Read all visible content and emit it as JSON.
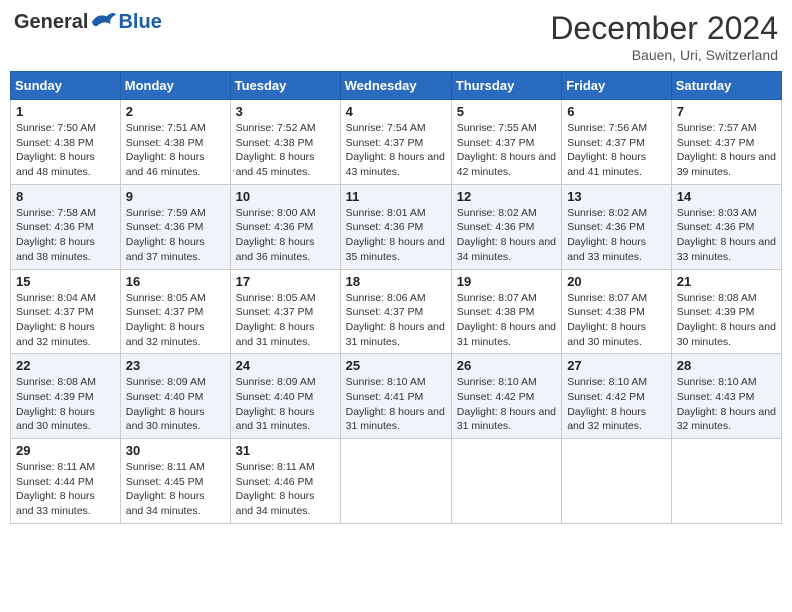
{
  "header": {
    "logo": {
      "general": "General",
      "blue": "Blue"
    },
    "title": "December 2024",
    "location": "Bauen, Uri, Switzerland"
  },
  "weekdays": [
    "Sunday",
    "Monday",
    "Tuesday",
    "Wednesday",
    "Thursday",
    "Friday",
    "Saturday"
  ],
  "weeks": [
    [
      {
        "day": "1",
        "sunrise": "Sunrise: 7:50 AM",
        "sunset": "Sunset: 4:38 PM",
        "daylight": "Daylight: 8 hours and 48 minutes."
      },
      {
        "day": "2",
        "sunrise": "Sunrise: 7:51 AM",
        "sunset": "Sunset: 4:38 PM",
        "daylight": "Daylight: 8 hours and 46 minutes."
      },
      {
        "day": "3",
        "sunrise": "Sunrise: 7:52 AM",
        "sunset": "Sunset: 4:38 PM",
        "daylight": "Daylight: 8 hours and 45 minutes."
      },
      {
        "day": "4",
        "sunrise": "Sunrise: 7:54 AM",
        "sunset": "Sunset: 4:37 PM",
        "daylight": "Daylight: 8 hours and 43 minutes."
      },
      {
        "day": "5",
        "sunrise": "Sunrise: 7:55 AM",
        "sunset": "Sunset: 4:37 PM",
        "daylight": "Daylight: 8 hours and 42 minutes."
      },
      {
        "day": "6",
        "sunrise": "Sunrise: 7:56 AM",
        "sunset": "Sunset: 4:37 PM",
        "daylight": "Daylight: 8 hours and 41 minutes."
      },
      {
        "day": "7",
        "sunrise": "Sunrise: 7:57 AM",
        "sunset": "Sunset: 4:37 PM",
        "daylight": "Daylight: 8 hours and 39 minutes."
      }
    ],
    [
      {
        "day": "8",
        "sunrise": "Sunrise: 7:58 AM",
        "sunset": "Sunset: 4:36 PM",
        "daylight": "Daylight: 8 hours and 38 minutes."
      },
      {
        "day": "9",
        "sunrise": "Sunrise: 7:59 AM",
        "sunset": "Sunset: 4:36 PM",
        "daylight": "Daylight: 8 hours and 37 minutes."
      },
      {
        "day": "10",
        "sunrise": "Sunrise: 8:00 AM",
        "sunset": "Sunset: 4:36 PM",
        "daylight": "Daylight: 8 hours and 36 minutes."
      },
      {
        "day": "11",
        "sunrise": "Sunrise: 8:01 AM",
        "sunset": "Sunset: 4:36 PM",
        "daylight": "Daylight: 8 hours and 35 minutes."
      },
      {
        "day": "12",
        "sunrise": "Sunrise: 8:02 AM",
        "sunset": "Sunset: 4:36 PM",
        "daylight": "Daylight: 8 hours and 34 minutes."
      },
      {
        "day": "13",
        "sunrise": "Sunrise: 8:02 AM",
        "sunset": "Sunset: 4:36 PM",
        "daylight": "Daylight: 8 hours and 33 minutes."
      },
      {
        "day": "14",
        "sunrise": "Sunrise: 8:03 AM",
        "sunset": "Sunset: 4:36 PM",
        "daylight": "Daylight: 8 hours and 33 minutes."
      }
    ],
    [
      {
        "day": "15",
        "sunrise": "Sunrise: 8:04 AM",
        "sunset": "Sunset: 4:37 PM",
        "daylight": "Daylight: 8 hours and 32 minutes."
      },
      {
        "day": "16",
        "sunrise": "Sunrise: 8:05 AM",
        "sunset": "Sunset: 4:37 PM",
        "daylight": "Daylight: 8 hours and 32 minutes."
      },
      {
        "day": "17",
        "sunrise": "Sunrise: 8:05 AM",
        "sunset": "Sunset: 4:37 PM",
        "daylight": "Daylight: 8 hours and 31 minutes."
      },
      {
        "day": "18",
        "sunrise": "Sunrise: 8:06 AM",
        "sunset": "Sunset: 4:37 PM",
        "daylight": "Daylight: 8 hours and 31 minutes."
      },
      {
        "day": "19",
        "sunrise": "Sunrise: 8:07 AM",
        "sunset": "Sunset: 4:38 PM",
        "daylight": "Daylight: 8 hours and 31 minutes."
      },
      {
        "day": "20",
        "sunrise": "Sunrise: 8:07 AM",
        "sunset": "Sunset: 4:38 PM",
        "daylight": "Daylight: 8 hours and 30 minutes."
      },
      {
        "day": "21",
        "sunrise": "Sunrise: 8:08 AM",
        "sunset": "Sunset: 4:39 PM",
        "daylight": "Daylight: 8 hours and 30 minutes."
      }
    ],
    [
      {
        "day": "22",
        "sunrise": "Sunrise: 8:08 AM",
        "sunset": "Sunset: 4:39 PM",
        "daylight": "Daylight: 8 hours and 30 minutes."
      },
      {
        "day": "23",
        "sunrise": "Sunrise: 8:09 AM",
        "sunset": "Sunset: 4:40 PM",
        "daylight": "Daylight: 8 hours and 30 minutes."
      },
      {
        "day": "24",
        "sunrise": "Sunrise: 8:09 AM",
        "sunset": "Sunset: 4:40 PM",
        "daylight": "Daylight: 8 hours and 31 minutes."
      },
      {
        "day": "25",
        "sunrise": "Sunrise: 8:10 AM",
        "sunset": "Sunset: 4:41 PM",
        "daylight": "Daylight: 8 hours and 31 minutes."
      },
      {
        "day": "26",
        "sunrise": "Sunrise: 8:10 AM",
        "sunset": "Sunset: 4:42 PM",
        "daylight": "Daylight: 8 hours and 31 minutes."
      },
      {
        "day": "27",
        "sunrise": "Sunrise: 8:10 AM",
        "sunset": "Sunset: 4:42 PM",
        "daylight": "Daylight: 8 hours and 32 minutes."
      },
      {
        "day": "28",
        "sunrise": "Sunrise: 8:10 AM",
        "sunset": "Sunset: 4:43 PM",
        "daylight": "Daylight: 8 hours and 32 minutes."
      }
    ],
    [
      {
        "day": "29",
        "sunrise": "Sunrise: 8:11 AM",
        "sunset": "Sunset: 4:44 PM",
        "daylight": "Daylight: 8 hours and 33 minutes."
      },
      {
        "day": "30",
        "sunrise": "Sunrise: 8:11 AM",
        "sunset": "Sunset: 4:45 PM",
        "daylight": "Daylight: 8 hours and 34 minutes."
      },
      {
        "day": "31",
        "sunrise": "Sunrise: 8:11 AM",
        "sunset": "Sunset: 4:46 PM",
        "daylight": "Daylight: 8 hours and 34 minutes."
      },
      null,
      null,
      null,
      null
    ]
  ]
}
